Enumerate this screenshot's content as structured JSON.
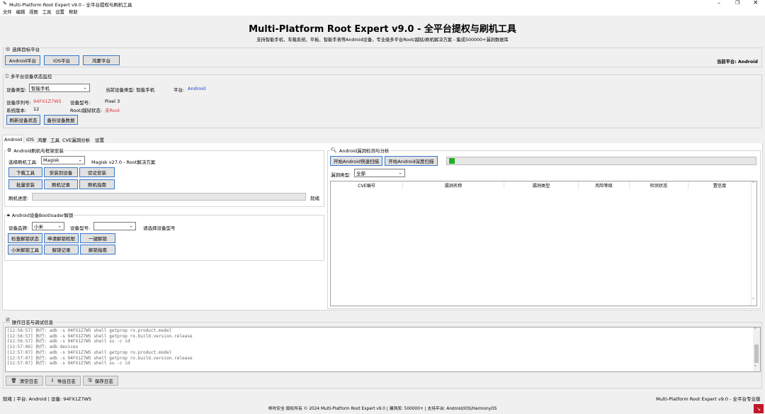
{
  "window": {
    "title": "Multi-Platform Root Expert v9.0 - 全平台提权与刷机工具",
    "menu": [
      "文件",
      "编辑",
      "视图",
      "工具",
      "设置",
      "帮助"
    ]
  },
  "banner": {
    "title": "Multi-Platform Root Expert v9.0 - 全平台提权与刷机工具",
    "subtitle": "支持智能手机、车载系统、平板、智能手表等Android设备，专业级多平台Root/越狱/刷机解决方案 - 集成500000+漏洞数据库"
  },
  "platform_select": {
    "header": "选择目标平台",
    "buttons": [
      "Android平台",
      "iOS平台",
      "鸿蒙平台"
    ],
    "current_label": "当前平台: Android"
  },
  "monitor": {
    "header": "多平台设备状态监控",
    "device_type_label": "设备类型:",
    "device_type_value": "智能手机",
    "current_type_label": "当前设备类型: 智能手机",
    "platform_label": "平台:",
    "platform_value": "Android",
    "serial_label": "设备序列号:",
    "serial_value": "94FX1Z7W5",
    "model_label": "设备型号:",
    "model_value": "Pixel 3",
    "version_label": "系统版本:",
    "version_value": "12",
    "root_label": "Root/越狱状态:",
    "root_value": "未Root",
    "refresh_button": "刷新设备状态",
    "backup_button": "备份设备数据"
  },
  "tabs": [
    "Android",
    "iOS",
    "鸿蒙",
    "工具",
    "CVE漏洞分析",
    "设置"
  ],
  "flash": {
    "header": "Android刷机与框架安装",
    "tool_label": "选择刷机工具:",
    "tool_value": "Magisk",
    "tool_desc": "Magisk v27.0 - Root解决方案",
    "buttons_row1": [
      "下载工具",
      "安装到设备",
      "验证安装"
    ],
    "buttons_row2": [
      "批量安装",
      "刷机记录",
      "刷机指南"
    ],
    "progress_label": "刷机进度:",
    "progress_status": "就绪",
    "progress_value": 0
  },
  "bootloader": {
    "header": "Android设备Bootloader解锁",
    "brand_label": "设备品牌:",
    "brand_value": "小米",
    "model_label": "设备型号:",
    "model_value": "",
    "model_hint": "请选择设备型号",
    "buttons_row1": [
      "检查解锁状态",
      "申请解锁权限",
      "一键解锁"
    ],
    "buttons_row2": [
      "小米解锁工具",
      "解锁记录",
      "解锁指南"
    ]
  },
  "vuln": {
    "header": "Android漏洞检测与分析",
    "quick_scan": "开始Android快速扫描",
    "deep_scan": "开始Android深度扫描",
    "type_label": "漏洞类型:",
    "type_value": "全部",
    "columns": [
      "CVE编号",
      "漏洞名称",
      "漏洞类型",
      "风险等级",
      "检测状态",
      "置信度"
    ],
    "status_color": "#1db31d"
  },
  "log": {
    "header": "操作日志与调试信息",
    "lines": [
      "[12:56:57] 执行: adb -s 94FX1Z7W5 shell getprop ro.product.model",
      "[12:56:57] 执行: adb -s 94FX1Z7W5 shell getprop ro.build.version.release",
      "[12:56:57] 执行: adb -s 94FX1Z7W5 shell su -c id",
      "[12:57:06] 执行: adb devices",
      "[12:57:07] 执行: adb -s 94FX1Z7W5 shell getprop ro.product.model",
      "[12:57:07] 执行: adb -s 94FX1Z7W5 shell getprop ro.build.version.release",
      "[12:57:07] 执行: adb -s 94FX1Z7W5 shell su -c id"
    ],
    "clear_button": "清空日志",
    "export_button": "导出日志",
    "save_button": "保存日志"
  },
  "status_bar": {
    "left": "就绪 | 平台: Android | 设备: 94FX1Z7W5",
    "right": "Multi-Platform Root Expert v9.0 - 全平台专业版",
    "footer": "哆吹安全 版权所有 © 2024 Multi-Platform Root Expert v9.0 | 漏洞库: 500000+ | 支持平台: Android/iOS/HarmonyOS"
  },
  "colors": {
    "accent_blue": "#3a78c8",
    "serial_red": "#e03030",
    "platform_blue": "#2244cc",
    "corner_badge": "#c0182a"
  }
}
